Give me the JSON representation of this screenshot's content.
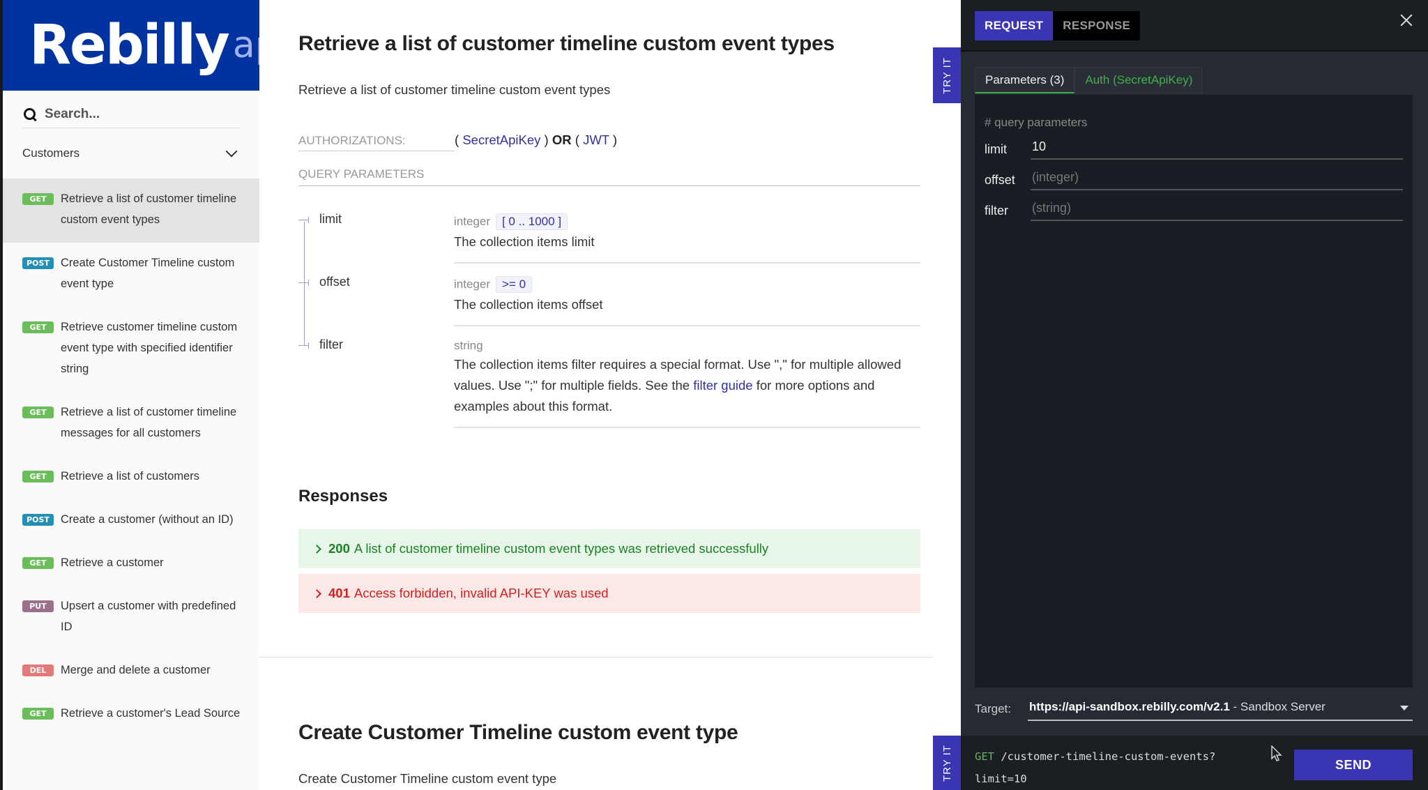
{
  "sidebar": {
    "logo": {
      "main": "Rebilly",
      "sub": "api"
    },
    "search": {
      "placeholder": "Search..."
    },
    "group": {
      "label": "Customers"
    },
    "items": [
      {
        "method": "GET",
        "label": "Retrieve a list of customer timeline custom event types",
        "active": true
      },
      {
        "method": "POST",
        "label": "Create Customer Timeline custom event type"
      },
      {
        "method": "GET",
        "label": "Retrieve customer timeline custom event type with specified identifier string"
      },
      {
        "method": "GET",
        "label": "Retrieve a list of customer timeline messages for all customers"
      },
      {
        "method": "GET",
        "label": "Retrieve a list of customers"
      },
      {
        "method": "POST",
        "label": "Create a customer (without an ID)"
      },
      {
        "method": "GET",
        "label": "Retrieve a customer"
      },
      {
        "method": "PUT",
        "label": "Upsert a customer with predefined ID"
      },
      {
        "method": "DEL",
        "label": "Merge and delete a customer"
      },
      {
        "method": "GET",
        "label": "Retrieve a customer's Lead Source"
      }
    ]
  },
  "main": {
    "title": "Retrieve a list of customer timeline custom event types",
    "description": "Retrieve a list of customer timeline custom event types",
    "authorizations": {
      "label": "AUTHORIZATIONS:",
      "open1": "( ",
      "scheme1": "SecretApiKey",
      "close1": " ) ",
      "or": "OR",
      "open2": " ( ",
      "scheme2": "JWT",
      "close2": " )"
    },
    "query_params_label": "QUERY PARAMETERS",
    "params": [
      {
        "name": "limit",
        "type": "integer",
        "constraint": "[ 0 .. 1000 ]",
        "description": "The collection items limit"
      },
      {
        "name": "offset",
        "type": "integer",
        "constraint": ">= 0",
        "description": "The collection items offset"
      },
      {
        "name": "filter",
        "type": "string",
        "constraint": "",
        "description_pre": "The collection items filter requires a special format. Use \",\" for multiple allowed values. Use \";\" for multiple fields. See the ",
        "description_link": "filter guide",
        "description_post": " for more options and examples about this format."
      }
    ],
    "responses_title": "Responses",
    "responses": [
      {
        "code": "200",
        "text": "A list of customer timeline custom event types was retrieved successfully",
        "status": "success"
      },
      {
        "code": "401",
        "text": "Access forbidden, invalid API-KEY was used",
        "status": "error"
      }
    ],
    "next_title": "Create Customer Timeline custom event type",
    "next_description": "Create Customer Timeline custom event type",
    "try_it_label": "TRY IT"
  },
  "panel": {
    "tabs": [
      {
        "label": "REQUEST",
        "active": true
      },
      {
        "label": "RESPONSE",
        "active": false
      }
    ],
    "subtabs": [
      {
        "label": "Parameters (3)",
        "active": true
      },
      {
        "label": "Auth (SecretApiKey)",
        "active": false
      }
    ],
    "query_comment": "# query parameters",
    "fields": [
      {
        "label": "limit",
        "value": "10",
        "placeholder": ""
      },
      {
        "label": "offset",
        "value": "",
        "placeholder": "(integer)"
      },
      {
        "label": "filter",
        "value": "",
        "placeholder": "(string)"
      }
    ],
    "target": {
      "label": "Target:",
      "url": "https://api-sandbox.rebilly.com/v2.1",
      "name": " - Sandbox Server"
    },
    "request": {
      "method": "GET",
      "path": " /customer-timeline-custom-events?",
      "query": "limit=10"
    },
    "send_label": "SEND"
  },
  "colors": {
    "brand": "#0033a0",
    "accent": "#3a35b2",
    "get": "#6bbd5b",
    "post": "#248fb2",
    "put": "#9b708b",
    "del": "#e27a7a",
    "success": "#1d8127",
    "error": "#d41f1c"
  }
}
